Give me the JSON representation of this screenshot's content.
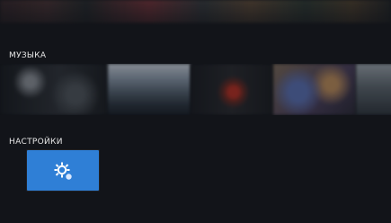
{
  "sections": {
    "music": {
      "title": "МУЗЫКА"
    },
    "settings": {
      "title": "НАСТРОЙКИ"
    }
  },
  "icons": {
    "settings_tile": "settings-gear-icon"
  },
  "colors": {
    "background": "#121419",
    "accent": "#2f7fd6",
    "text": "#e8e8e8"
  }
}
